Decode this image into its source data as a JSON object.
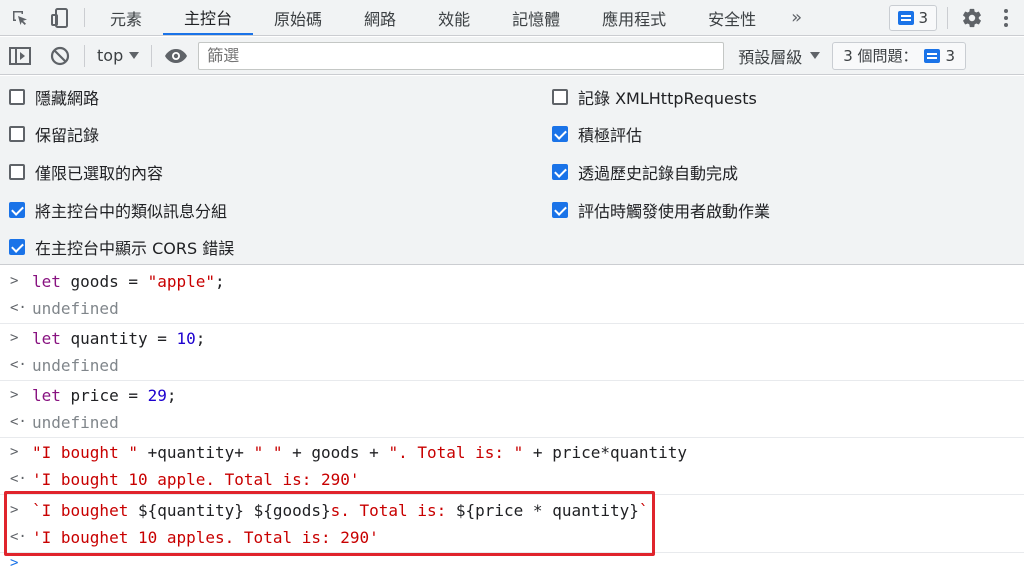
{
  "tabbar": {
    "tabs": [
      "元素",
      "主控台",
      "原始碼",
      "網路",
      "效能",
      "記憶體",
      "應用程式",
      "安全性"
    ],
    "active_tab": "主控台",
    "more_label": "»",
    "messages_count": "3"
  },
  "toolbar": {
    "context": "top",
    "filter_placeholder": "篩選",
    "levels_label": "預設層級",
    "issues_label": "3 個問題：",
    "issues_count": "3"
  },
  "settings": {
    "left": [
      {
        "label": "隱藏網路",
        "checked": false
      },
      {
        "label": "保留記錄",
        "checked": false
      },
      {
        "label": "僅限已選取的內容",
        "checked": false
      },
      {
        "label": "將主控台中的類似訊息分組",
        "checked": true
      },
      {
        "label": "在主控台中顯示 CORS 錯誤",
        "checked": true
      }
    ],
    "right": [
      {
        "label": "記錄 XMLHttpRequests",
        "checked": false
      },
      {
        "label": "積極評估",
        "checked": true
      },
      {
        "label": "透過歷史記錄自動完成",
        "checked": true
      },
      {
        "label": "評估時觸發使用者啟動作業",
        "checked": true
      }
    ]
  },
  "console": {
    "input_glyph": ">",
    "output_glyph": "<·",
    "prompt_glyph": ">",
    "l1": {
      "kw": "let",
      "mid": " goods = ",
      "val": "\"apple\"",
      "end": ";"
    },
    "r1": "undefined",
    "l2": {
      "kw": "let",
      "mid": " quantity = ",
      "val": "10",
      "end": ";"
    },
    "r2": "undefined",
    "l3": {
      "kw": "let",
      "mid": " price = ",
      "val": "29",
      "end": ";"
    },
    "r3": "undefined",
    "l4": {
      "s1": "\"I bought \"",
      "p1": " +quantity+ ",
      "s2": "\" \"",
      "p2": " + goods + ",
      "s3": "\". Total is: \"",
      "p3": " + price*quantity"
    },
    "r4": "'I bought 10 apple. Total is: 290'",
    "l5": {
      "s1": "`I boughet ",
      "p1": "${quantity} ${goods}",
      "s2": "s. Total is: ",
      "p2": "${price * quantity}",
      "s3": "`"
    },
    "r5": "'I boughet 10 apples. Total is: 290'"
  },
  "colors": {
    "accent": "#1a73e8",
    "highlight_box": "#e0242c",
    "string": "#c80000",
    "keyword": "#881280",
    "number": "#1c00cf"
  }
}
